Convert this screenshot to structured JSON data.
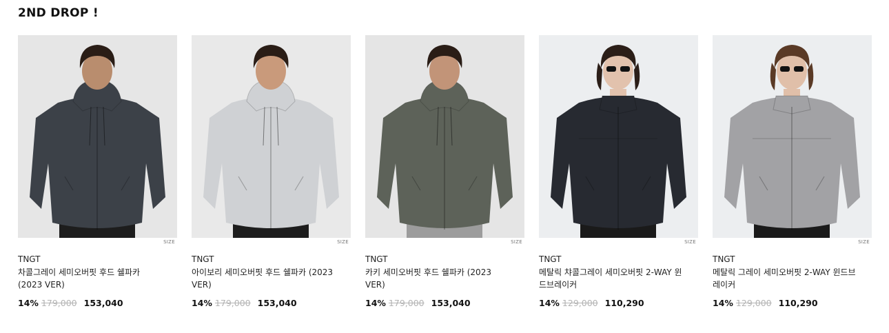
{
  "section_title": "2ND DROP !",
  "products": [
    {
      "brand": "TNGT",
      "name": "차콜그레이 세미오버핏 후드 쉘파카 (2023 VER)",
      "size_label": "SIZE",
      "discount": "14%",
      "original_price": "179,000",
      "sale_price": "153,040",
      "bg_color": "#e6e6e6",
      "jacket_color": "#3c4148",
      "pants_color": "#1d1d1d",
      "skin_color": "#b98d6e",
      "hair_color": "#2a1d16",
      "hood": true,
      "sunglasses": false
    },
    {
      "brand": "TNGT",
      "name": "아이보리 세미오버핏 후드 쉘파카 (2023 VER)",
      "size_label": "SIZE",
      "discount": "14%",
      "original_price": "179,000",
      "sale_price": "153,040",
      "bg_color": "#e9e9e9",
      "jacket_color": "#cfd1d4",
      "pants_color": "#1d1d1d",
      "skin_color": "#c99a7b",
      "hair_color": "#2a1d16",
      "hood": true,
      "sunglasses": false
    },
    {
      "brand": "TNGT",
      "name": "카키 세미오버핏 후드 쉘파카 (2023 VER)",
      "size_label": "SIZE",
      "discount": "14%",
      "original_price": "179,000",
      "sale_price": "153,040",
      "bg_color": "#e5e5e5",
      "jacket_color": "#5d6259",
      "pants_color": "#9c9c9c",
      "skin_color": "#c29478",
      "hair_color": "#2a1d16",
      "hood": true,
      "sunglasses": false
    },
    {
      "brand": "TNGT",
      "name": "메탈릭 챠콜그레이 세미오버핏 2-WAY 윈드브레이커",
      "size_label": "SIZE",
      "discount": "14%",
      "original_price": "129,000",
      "sale_price": "110,290",
      "bg_color": "#eceef0",
      "jacket_color": "#272a31",
      "pants_color": "#1a1a1a",
      "skin_color": "#e2c2ad",
      "hair_color": "#2b1e18",
      "hood": false,
      "sunglasses": true
    },
    {
      "brand": "TNGT",
      "name": "메탈릭 그레이 세미오버핏 2-WAY 윈드브레이커",
      "size_label": "SIZE",
      "discount": "14%",
      "original_price": "129,000",
      "sale_price": "110,290",
      "bg_color": "#eceef0",
      "jacket_color": "#a2a2a5",
      "pants_color": "#1a1a1a",
      "skin_color": "#e0bfa9",
      "hair_color": "#5a3a26",
      "hood": false,
      "sunglasses": true
    }
  ]
}
